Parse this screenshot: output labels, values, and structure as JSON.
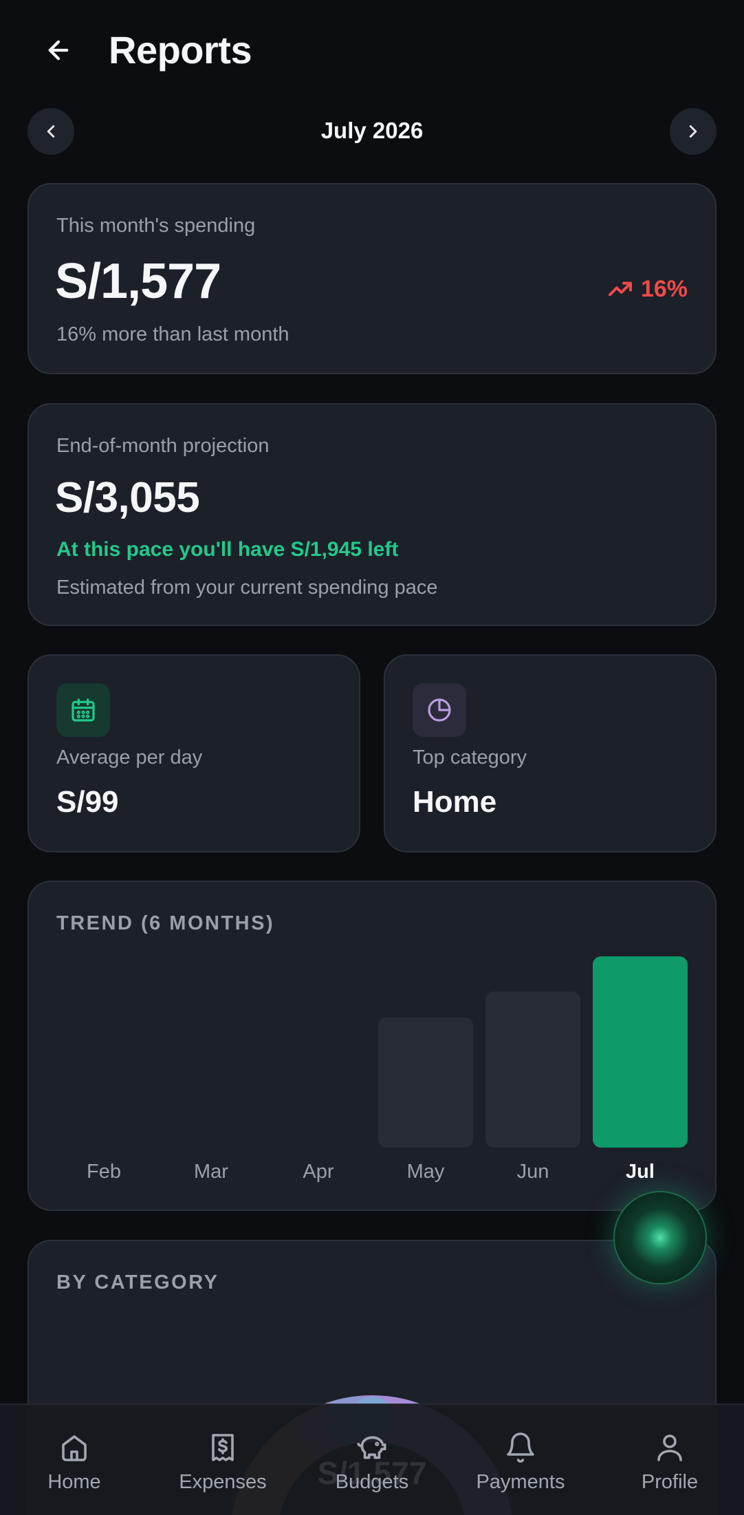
{
  "header": {
    "title": "Reports"
  },
  "month_nav": {
    "label": "July 2026"
  },
  "spending": {
    "label": "This month's spending",
    "amount": "S/1,577",
    "change": "16%",
    "sub": "16% more than last month",
    "change_color": "#ef4a4a"
  },
  "projection": {
    "label": "End-of-month projection",
    "amount": "S/3,055",
    "note": "At this pace you'll have S/1,945 left",
    "sub": "Estimated from your current spending pace",
    "note_color": "#22c98b"
  },
  "avg_per_day": {
    "icon": "calendar-icon",
    "label": "Average per day",
    "value": "S/99"
  },
  "top_category": {
    "icon": "pie-chart-icon",
    "label": "Top category",
    "value": "Home"
  },
  "trend": {
    "title": "TREND (6 MONTHS)",
    "chart_data": {
      "type": "bar",
      "categories": [
        "Feb",
        "Mar",
        "Apr",
        "May",
        "Jun",
        "Jul"
      ],
      "values": [
        0,
        0,
        0,
        1075,
        1287,
        1577
      ],
      "highlight_index": 5,
      "bar_color": "#272c35",
      "highlight_color": "#0f9a6a"
    }
  },
  "by_category": {
    "title": "BY CATEGORY",
    "ghost_amount": "S/1,577",
    "segment_colors": [
      "#c8946a",
      "#c58dc4",
      "#8b98cf",
      "#a78bd4",
      "#7fa6d4"
    ]
  },
  "bottom_nav": {
    "items": [
      {
        "label": "Home",
        "icon": "home-icon"
      },
      {
        "label": "Expenses",
        "icon": "receipt-icon"
      },
      {
        "label": "Budgets",
        "icon": "piggy-bank-icon"
      },
      {
        "label": "Payments",
        "icon": "bell-icon"
      },
      {
        "label": "Profile",
        "icon": "user-icon"
      }
    ]
  }
}
